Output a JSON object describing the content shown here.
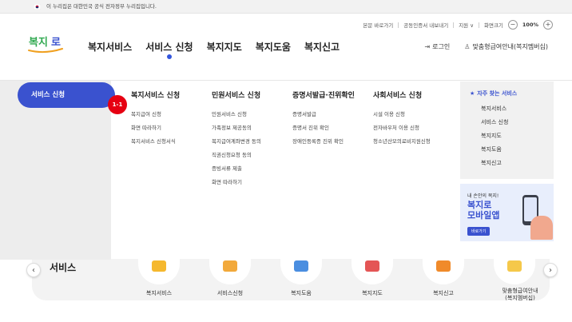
{
  "gov_banner": {
    "text": "이 누리집은 대한민국 공식 전자정부 누리집입니다."
  },
  "utility": {
    "skip": "본문 바로가기",
    "cert": "공동인증서 내보내기",
    "support": "지원 ∨",
    "zoom_label": "화면크기",
    "zoom_minus": "−",
    "zoom_value": "100%",
    "zoom_plus": "+"
  },
  "header": {
    "logo_text": "복지로",
    "nav": [
      "복지서비스",
      "서비스 신청",
      "복지지도",
      "복지도움",
      "복지신고"
    ],
    "active_index": 1,
    "login": "로그인",
    "custom_guide": "맞춤형급여안내(복지멤버십)"
  },
  "mega_menu": {
    "selected": "서비스 신청",
    "badge": "1-1",
    "columns": [
      {
        "title": "복지서비스 신청",
        "links": [
          "복지급여 신청",
          "화면 따라하기",
          "복지서비스 신청서식"
        ]
      },
      {
        "title": "민원서비스 신청",
        "links": [
          "민원서비스 신청",
          "가족정보 제공동의",
          "복지급여계좌변경 동의",
          "직권신청요청 동의",
          "증빙서류 제출",
          "화면 따라하기"
        ]
      },
      {
        "title": "증명서발급·진위확인",
        "links": [
          "증명서발급",
          "증명서 진위 확인",
          "장애인등록증 진위 확인"
        ]
      },
      {
        "title": "사회서비스 신청",
        "links": [
          "시설 이용 신청",
          "전자바우처 이용 신청",
          "청소년산모의료비지원신청"
        ]
      }
    ],
    "quick": {
      "title": "자주 찾는 서비스",
      "items": [
        "복지서비스",
        "서비스 신청",
        "복지지도",
        "복지도움",
        "복지신고"
      ]
    },
    "promo": {
      "line1": "내 손안의 복지!",
      "line2": "복지로",
      "line3": "모바일앱",
      "button": "바로가기"
    }
  },
  "services": {
    "title": "서비스",
    "items": [
      {
        "label": "복지서비스",
        "color": "#f5b82e"
      },
      {
        "label": "서비스신청",
        "color": "#f2a93b"
      },
      {
        "label": "복지도움",
        "color": "#4a8ee0"
      },
      {
        "label": "복지지도",
        "color": "#e45555"
      },
      {
        "label": "복지신고",
        "color": "#f08a2a"
      },
      {
        "label": "맞춤형급여안내\n(복지멤버십)",
        "color": "#f5c84a"
      }
    ],
    "prev": "‹",
    "next": "›"
  },
  "colors": {
    "primary": "#3a52cf",
    "badge": "#e60012"
  }
}
